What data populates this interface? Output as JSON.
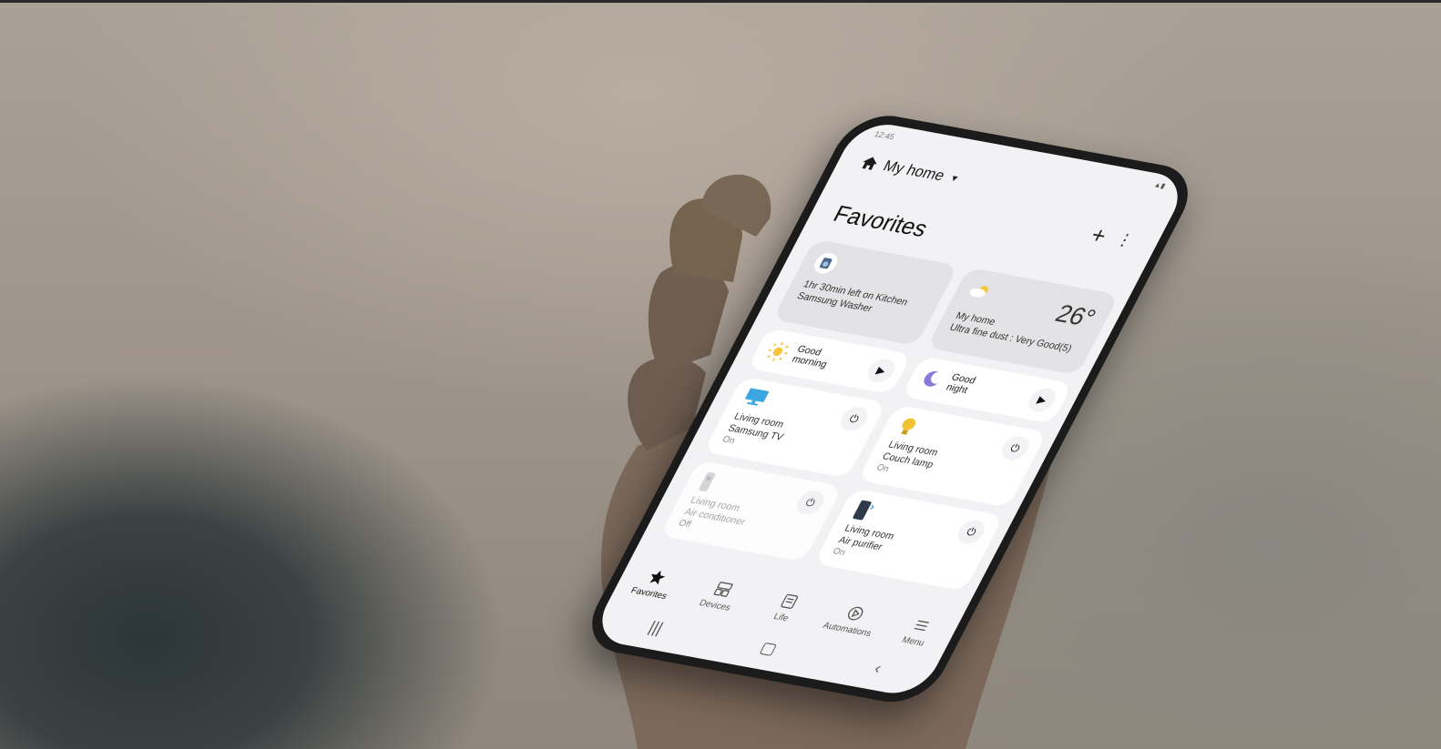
{
  "status": {
    "time": "12:45",
    "icons": "▲▮"
  },
  "header": {
    "home_name": "My home"
  },
  "page": {
    "title": "Favorites"
  },
  "cards": {
    "washer": {
      "text": "1hr 30min left on Kitchen Samsung Washer"
    },
    "weather": {
      "temp": "26°",
      "location": "My home",
      "detail": "Ultra fine dust : Very Good(5)"
    },
    "morning": {
      "label1": "Good",
      "label2": "morning"
    },
    "night": {
      "label1": "Good",
      "label2": "night"
    },
    "tv": {
      "name1": "Living room",
      "name2": "Samsung TV",
      "status": "On"
    },
    "lamp": {
      "name1": "Living room",
      "name2": "Couch lamp",
      "status": "On"
    },
    "ac": {
      "name1": "Living room",
      "name2": "Air conditioner",
      "status": "Off"
    },
    "purifier": {
      "name1": "Living room",
      "name2": "Air purifier",
      "status": "On"
    }
  },
  "nav": [
    {
      "label": "Favorites",
      "icon": "star-icon"
    },
    {
      "label": "Devices",
      "icon": "devices-icon"
    },
    {
      "label": "Life",
      "icon": "life-icon"
    },
    {
      "label": "Automations",
      "icon": "automations-icon"
    },
    {
      "label": "Menu",
      "icon": "menu-icon"
    }
  ],
  "colors": {
    "accent": "#1a1a1a",
    "sun": "#f5c542",
    "moon": "#8a7ad8",
    "tv": "#3ba6e0",
    "lamp": "#f1c232"
  }
}
